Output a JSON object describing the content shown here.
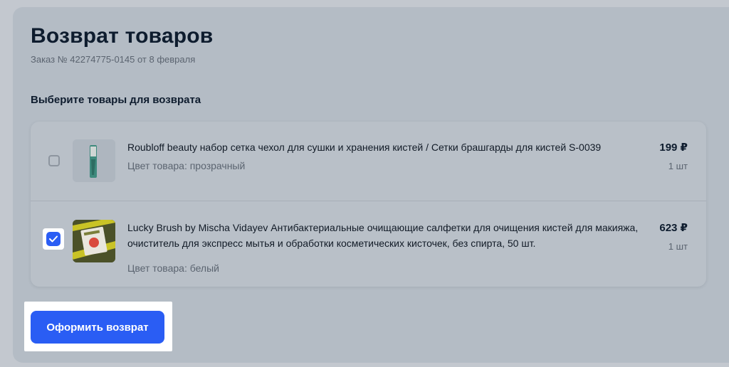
{
  "page": {
    "title": "Возврат товаров",
    "subtitle": "Заказ № 42274775-0145 от 8 февраля",
    "section_title": "Выберите товары для возврата"
  },
  "items": [
    {
      "name": "Roubloff beauty набор сетка чехол для сушки и хранения кистей / Сетки брашгарды для кистей S-0039",
      "color": "Цвет товара: прозрачный",
      "price": "199 ₽",
      "qty": "1 шт",
      "checked": false,
      "thumb_icon": "brush-guard-product-image"
    },
    {
      "name": "Lucky Brush by Mischa Vidayev Антибактериальные очищающие салфетки для очищения кистей для макияжа, очиститель для экспресс мытья и обработки косметических кисточек, без спирта, 50 шт.",
      "color": "Цвет товара: белый",
      "price": "623 ₽",
      "qty": "1 шт",
      "checked": true,
      "thumb_icon": "wipes-package-product-image"
    }
  ],
  "actions": {
    "submit_label": "Оформить возврат"
  },
  "colors": {
    "accent": "#2a5df4",
    "background": "#c3c8cf"
  }
}
